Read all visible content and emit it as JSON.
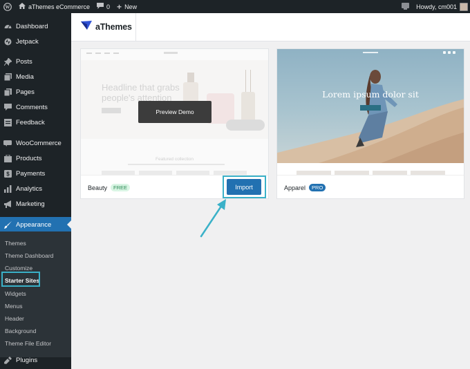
{
  "adminbar": {
    "site_name": "aThemes eCommerce",
    "comments_count": "0",
    "new_label": "New",
    "howdy": "Howdy, cm001"
  },
  "sidebar": {
    "items": [
      {
        "label": "Dashboard",
        "icon": "dashboard-icon"
      },
      {
        "label": "Jetpack",
        "icon": "jetpack-icon"
      },
      {
        "label": "Posts",
        "icon": "pin-icon"
      },
      {
        "label": "Media",
        "icon": "media-icon"
      },
      {
        "label": "Pages",
        "icon": "pages-icon"
      },
      {
        "label": "Comments",
        "icon": "comment-icon"
      },
      {
        "label": "Feedback",
        "icon": "feedback-icon"
      },
      {
        "label": "WooCommerce",
        "icon": "woo-icon"
      },
      {
        "label": "Products",
        "icon": "products-icon"
      },
      {
        "label": "Payments",
        "icon": "dollar-icon"
      },
      {
        "label": "Analytics",
        "icon": "bar-chart-icon"
      },
      {
        "label": "Marketing",
        "icon": "megaphone-icon"
      },
      {
        "label": "Appearance",
        "icon": "brush-icon"
      },
      {
        "label": "Plugins",
        "icon": "plug-icon"
      }
    ],
    "submenu": [
      "Themes",
      "Theme Dashboard",
      "Customize",
      "Starter Sites",
      "Widgets",
      "Menus",
      "Header",
      "Background",
      "Theme File Editor"
    ],
    "active_color": "#2271b1",
    "highlight_color": "#3ab1c8"
  },
  "header": {
    "brand": "aThemes"
  },
  "cards": [
    {
      "name": "Beauty",
      "badge": "FREE",
      "preview_label": "Preview Demo",
      "import_label": "Import",
      "headline": "Headline that grabs people's attention",
      "section_title": "Featured collection"
    },
    {
      "name": "Apparel",
      "badge": "PRO",
      "headline": "Lorem ipsum dolor sit"
    }
  ]
}
